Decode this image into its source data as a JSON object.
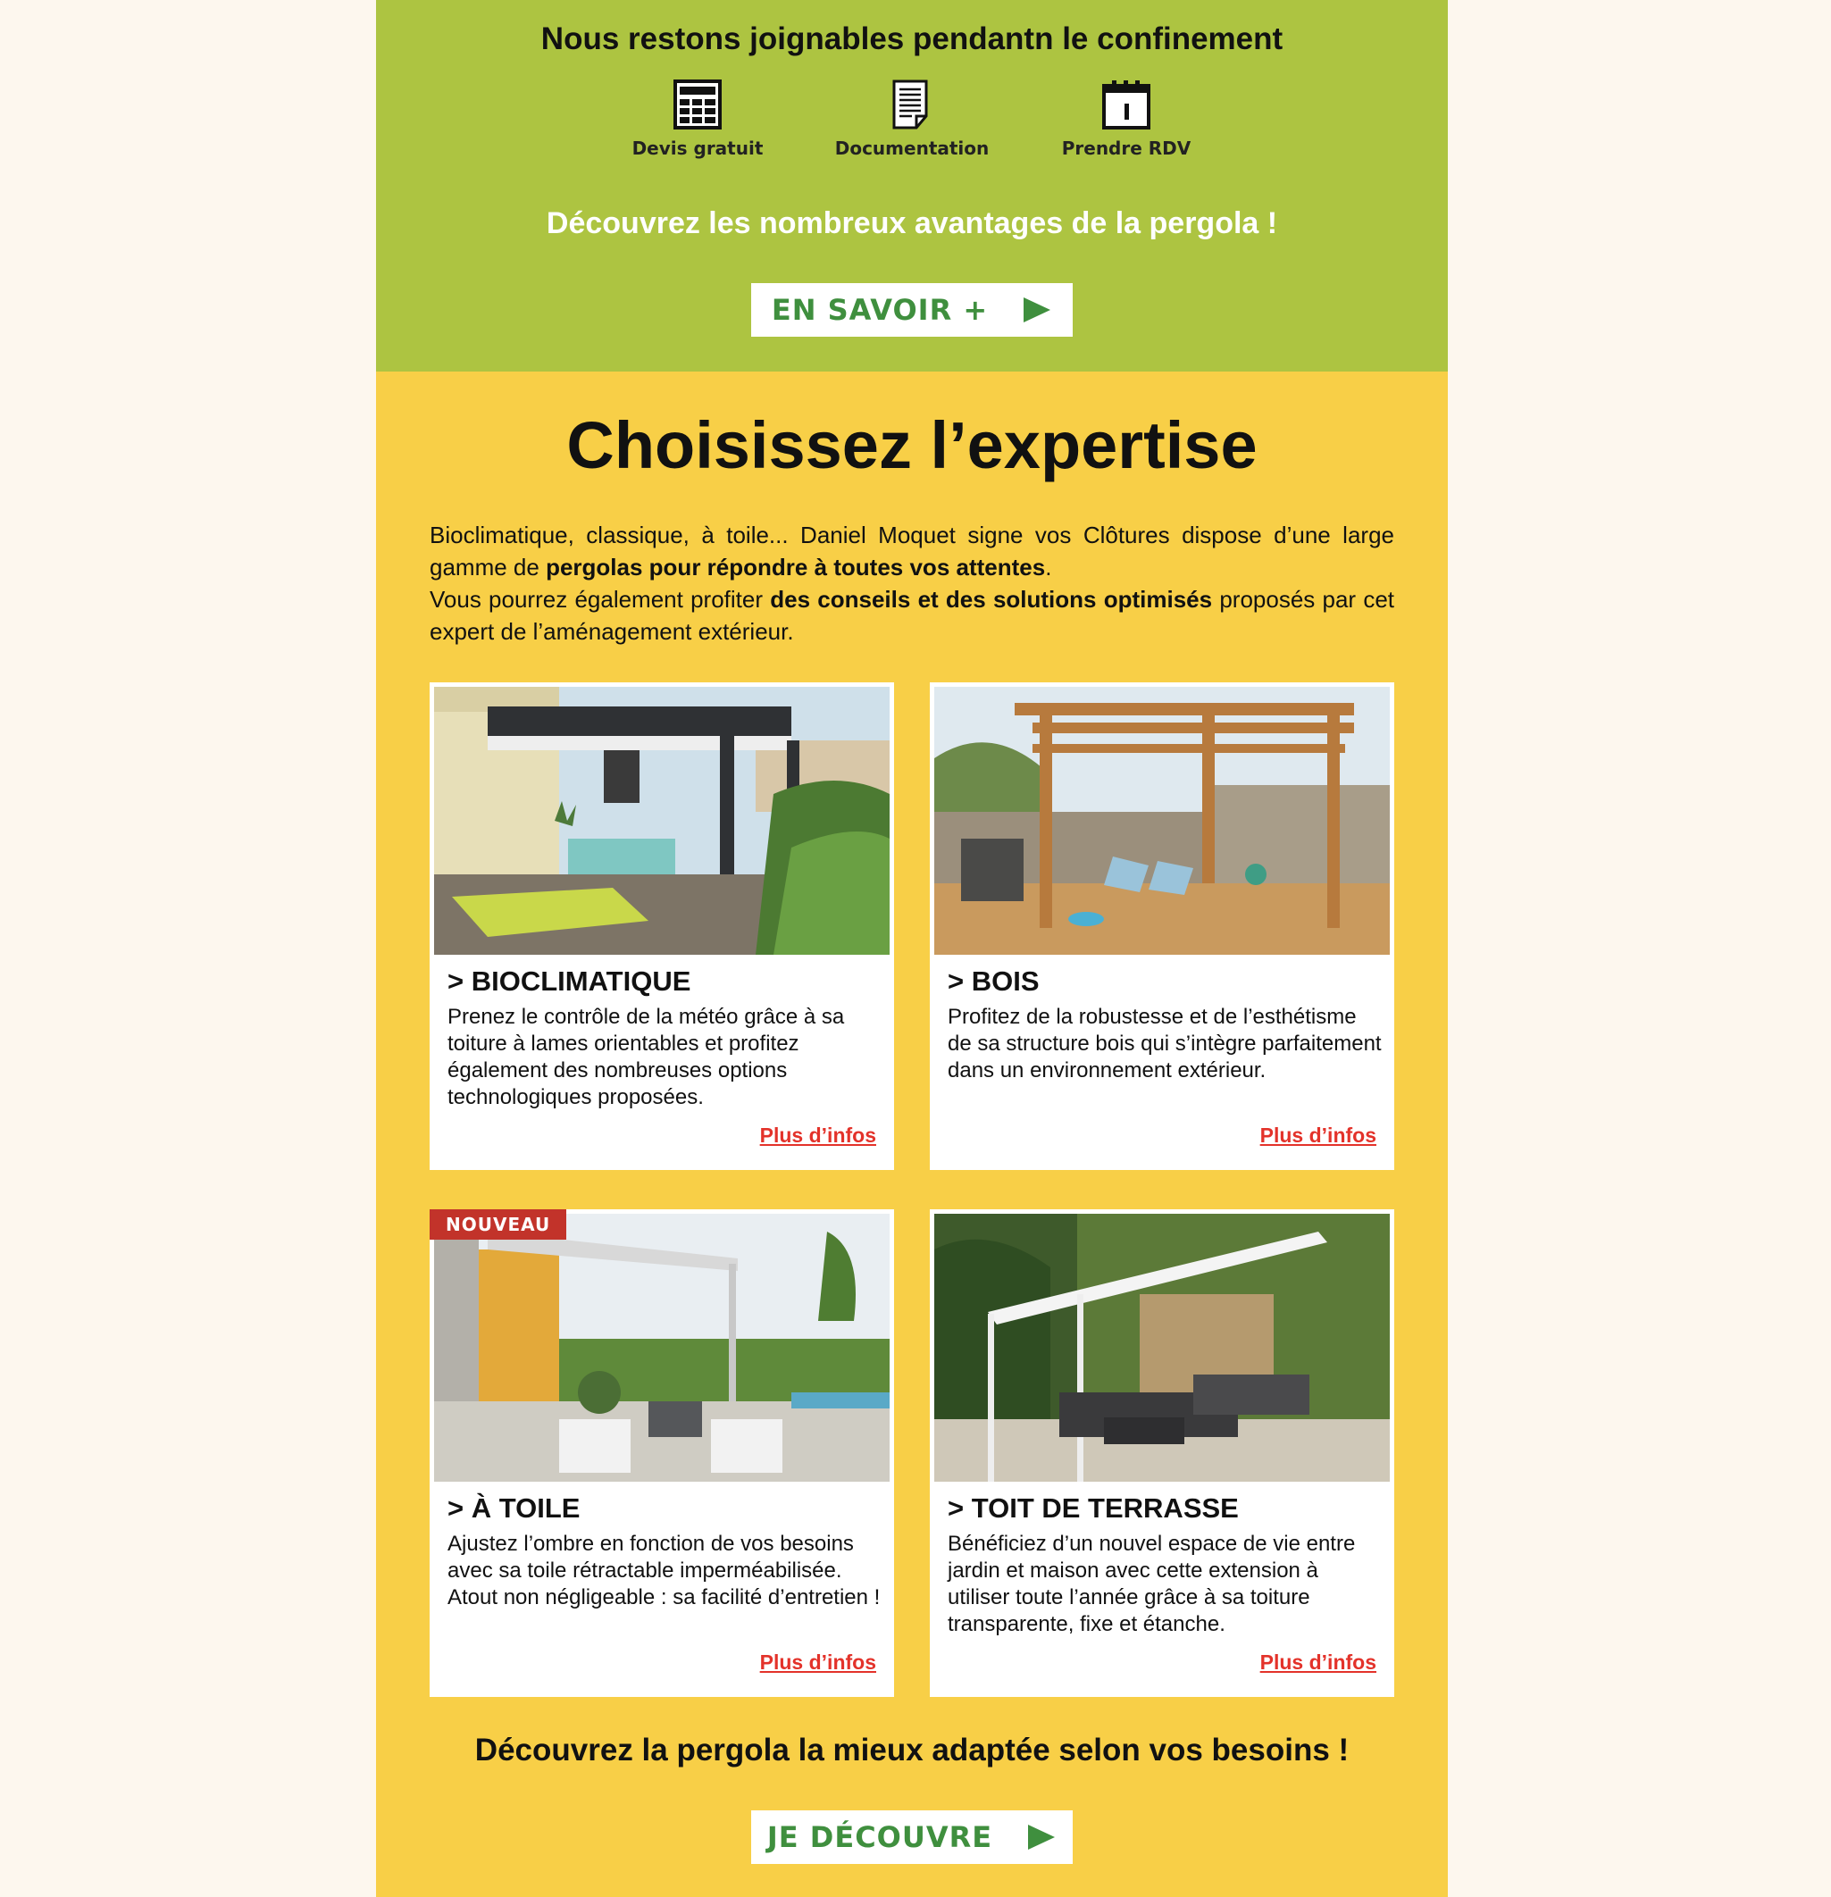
{
  "header": {
    "title": "Nous restons joignables pendantn le confinement",
    "features": [
      {
        "label": "Devis gratuit",
        "icon": "calculator-icon"
      },
      {
        "label": "Documentation",
        "icon": "document-icon"
      },
      {
        "label": "Prendre RDV",
        "icon": "calendar-icon"
      }
    ],
    "subtitle": "Découvrez les nombreux avantages de la pergola !",
    "cta_label": "EN SAVOIR +"
  },
  "main": {
    "title": "Choisissez l’expertise",
    "intro": [
      {
        "text": "Bioclimatique, classique, à toile... Daniel Moquet signe vos Clôtures dispose d’une large gamme de ",
        "bold": false
      },
      {
        "text": "pergolas pour répondre à toutes vos attentes",
        "bold": true
      },
      {
        "text": ".",
        "bold": false
      },
      {
        "text": "Vous pourrez également profiter ",
        "bold": false
      },
      {
        "text": "des conseils et des solutions optimisés",
        "bold": true
      },
      {
        "text": " proposés par cet expert de l’aménagement extérieur.",
        "bold": false
      }
    ],
    "cards": [
      {
        "title": "> BIOCLIMATIQUE",
        "text": "Prenez le contrôle de la météo grâce à sa toiture à lames orientables et profitez également des nombreuses options technologiques proposées.",
        "link": "Plus d’infos"
      },
      {
        "title": "> BOIS",
        "text": "Profitez de la robustesse et de l’esthétisme de sa structure bois qui s’intègre parfaitement dans un environnement extérieur.",
        "link": "Plus d’infos"
      },
      {
        "title": "> À TOILE",
        "text": "Ajustez l’ombre en fonction de vos besoins avec sa toile rétractable imperméabilisée. Atout non négligeable : sa facilité d’entretien !",
        "link": "Plus d’infos",
        "badge": "NOUVEAU"
      },
      {
        "title": "> TOIT DE TERRASSE",
        "text": "Bénéficiez d’un nouvel espace de vie entre jardin et maison avec cette extension à utiliser toute l’année grâce à sa toiture transparente, fixe et étanche.",
        "link": "Plus d’infos"
      }
    ],
    "subtitle": "Découvrez la pergola la mieux adaptée selon vos besoins !",
    "cta_label": "JE DÉCOUVRE"
  },
  "colors": {
    "page_bg": "#fdf7ee",
    "green_band": "#adc441",
    "yellow_band": "#f8cf47",
    "cta_text": "#3f8f3e",
    "link": "#e3322a",
    "badge": "#c2332a"
  }
}
